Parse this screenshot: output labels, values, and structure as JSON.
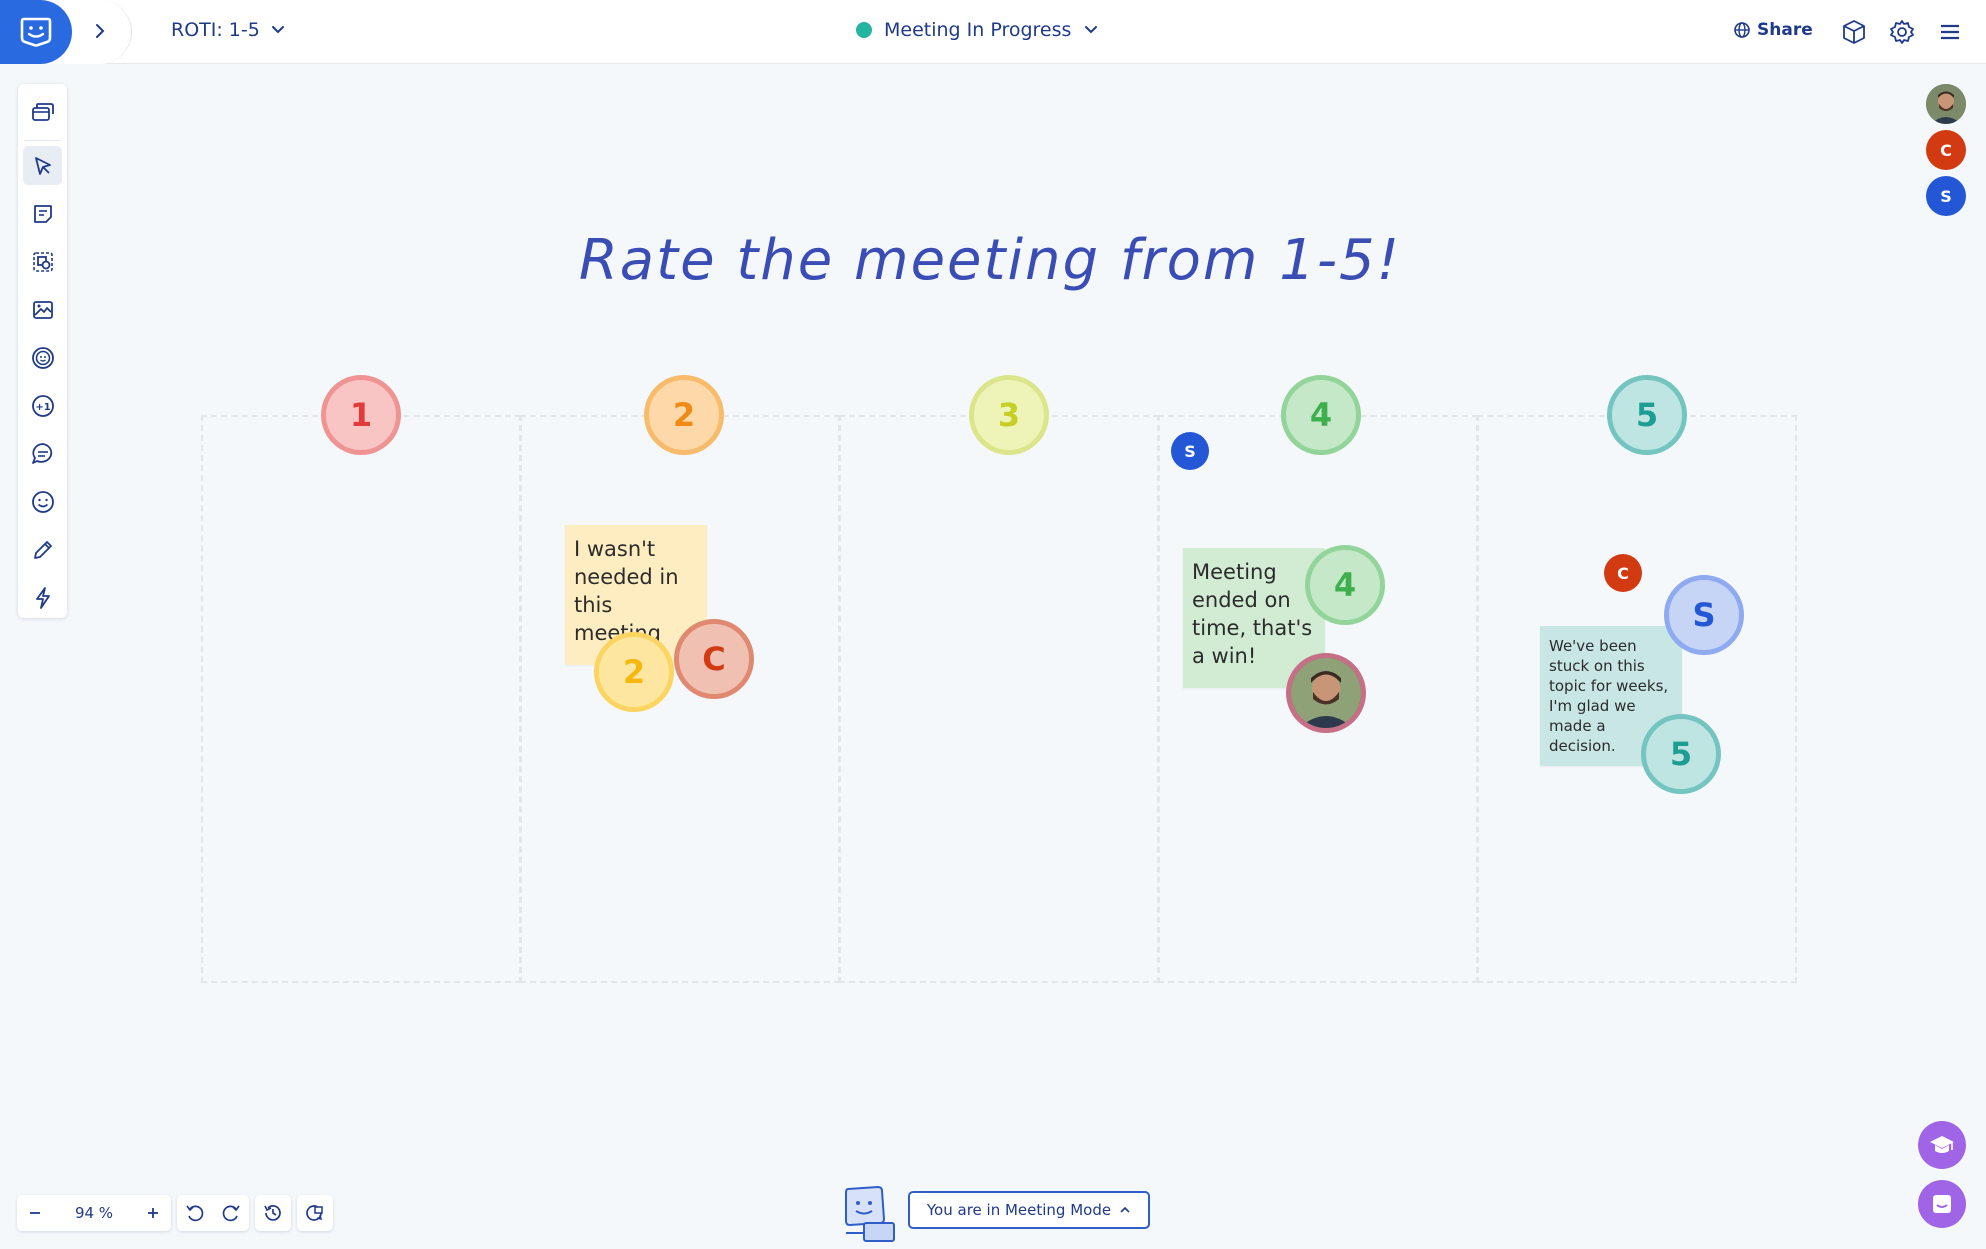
{
  "header": {
    "board_title": "ROTI: 1-5",
    "meeting_status": "Meeting In Progress",
    "share_label": "Share",
    "status_color": "#26b3a0",
    "brand_color": "#2a6ae0"
  },
  "toolbar": {
    "tools": [
      "frames-icon",
      "select-icon",
      "sticky-note-icon",
      "shapes-icon",
      "image-icon",
      "reactions-icon",
      "vote-icon",
      "comment-icon",
      "emoji-icon",
      "pen-icon",
      "templates-icon"
    ]
  },
  "presence": [
    {
      "initial": "",
      "kind": "photo"
    },
    {
      "initial": "C",
      "color": "#d23a12"
    },
    {
      "initial": "S",
      "color": "#2457d6"
    }
  ],
  "board": {
    "heading": "Rate the meeting from 1-5!",
    "columns": [
      {
        "rating": "1"
      },
      {
        "rating": "2"
      },
      {
        "rating": "3"
      },
      {
        "rating": "4"
      },
      {
        "rating": "5"
      }
    ],
    "stickies": [
      {
        "text": "I wasn't needed in this meeting",
        "color": "#fdedc1"
      },
      {
        "text": "Meeting ended on time, that's a win!",
        "color": "#d2ecd4"
      },
      {
        "text": "We've been stuck on this topic for weeks, I'm glad we made a decision.",
        "color": "#c8e6e4"
      }
    ],
    "votes": {
      "col2_rating": "2",
      "col2_user": "C",
      "col4_rating": "4",
      "col4_user_small": "S",
      "col5_rating": "5",
      "col5_user": "S",
      "col5_user_small": "C"
    }
  },
  "footer": {
    "zoom": "94 %",
    "meeting_mode_label": "You are in Meeting Mode"
  }
}
